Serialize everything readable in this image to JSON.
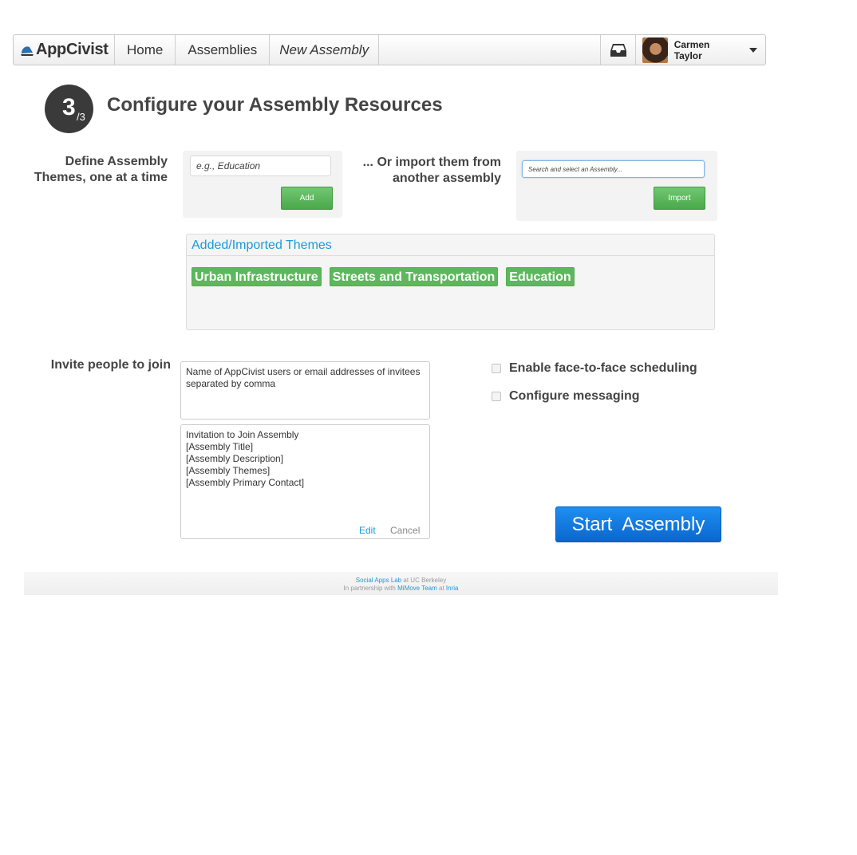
{
  "navbar": {
    "brand": "AppCivist",
    "links": [
      "Home",
      "Assemblies"
    ],
    "current": "New Assembly",
    "inbox_icon": "inbox-icon",
    "user_name": "Carmen Taylor"
  },
  "step": {
    "number": "3",
    "total": "/3",
    "title": "Configure your Assembly Resources"
  },
  "themes": {
    "define_label_line1": "Define Assembly",
    "define_label_line2": "Themes, one at a time",
    "theme_placeholder": "e.g., Education",
    "add_label": "Add",
    "import_label_line1": "... Or import them from",
    "import_label_line2": "another assembly",
    "search_placeholder": "Search and select an Assembly...",
    "import_button": "Import",
    "added_heading": "Added/Imported Themes",
    "tags": [
      "Urban Infrastructure",
      "Streets and Transportation",
      "Education"
    ]
  },
  "invite": {
    "label": "Invite people to join",
    "invitees_placeholder": "Name of AppCivist users or email addresses of invitees separated by comma",
    "message_lines": [
      "Invitation to Join Assembly",
      "[Assembly Title]",
      "[Assembly Description]",
      "[Assembly Themes]",
      "[Assembly Primary Contact]"
    ],
    "edit": "Edit",
    "cancel": "Cancel"
  },
  "options": {
    "face_to_face": "Enable face-to-face scheduling",
    "messaging": "Configure messaging"
  },
  "start_button": "Start  Assembly",
  "footer": {
    "lab": "Social Apps Lab",
    "at1": "at UC Berkeley",
    "partnership": "In partnership with",
    "team": "MiMove Team",
    "at2": "at",
    "inria": "Inria"
  },
  "colors": {
    "link_blue": "#1a9bd7",
    "tag_green": "#5cb85c",
    "start_blue": "#0a66d0"
  }
}
